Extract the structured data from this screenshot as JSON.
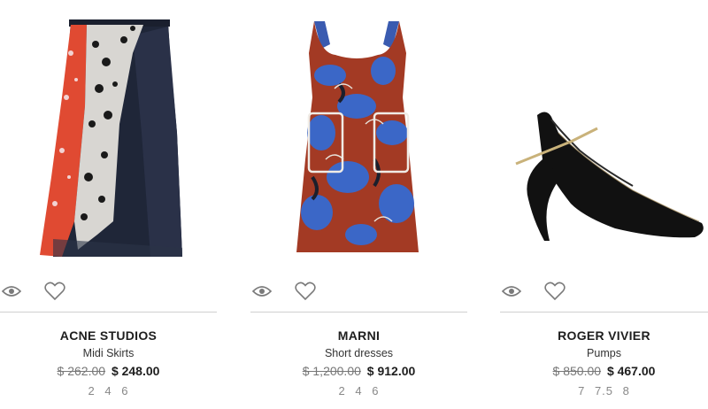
{
  "products": [
    {
      "brand": "ACNE STUDIOS",
      "category": "Midi Skirts",
      "old_price": "$ 262.00",
      "new_price": "$ 248.00",
      "sizes": [
        "2",
        "4",
        "6"
      ],
      "image_icon": "skirt-image"
    },
    {
      "brand": "MARNI",
      "category": "Short dresses",
      "old_price": "$ 1,200.00",
      "new_price": "$ 912.00",
      "sizes": [
        "2",
        "4",
        "6"
      ],
      "image_icon": "dress-image"
    },
    {
      "brand": "ROGER VIVIER",
      "category": "Pumps",
      "old_price": "$ 850.00",
      "new_price": "$ 467.00",
      "sizes": [
        "7",
        "7.5",
        "8"
      ],
      "image_icon": "pump-shoe-image"
    }
  ],
  "colors": {
    "divider": "#cfcfcf",
    "icon": "#7a7a7a",
    "old_price": "#777777",
    "sizes": "#888888"
  }
}
